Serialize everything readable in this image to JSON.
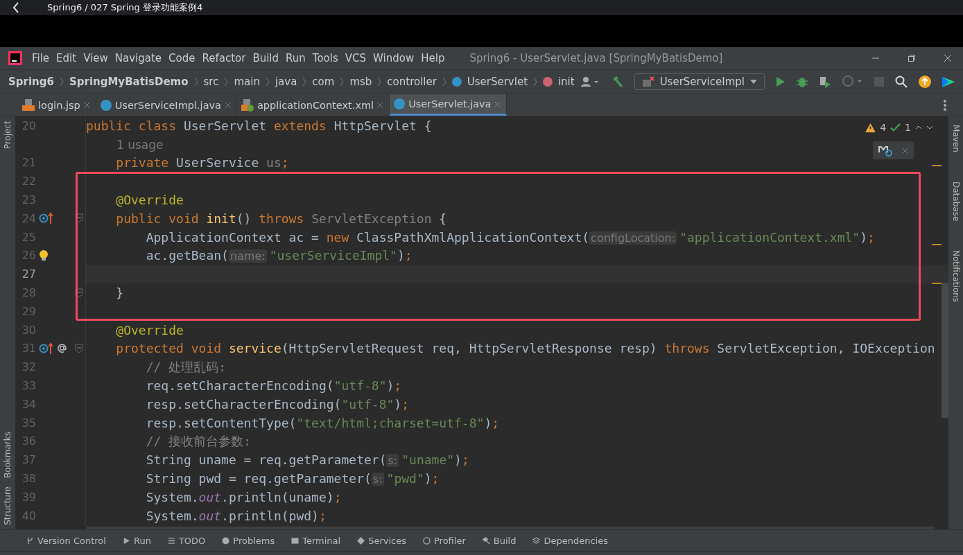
{
  "video_bar": {
    "title": "Spring6 / 027 Spring 登录功能案例4"
  },
  "window": {
    "title": "Spring6 - UserServlet.java [SpringMyBatisDemo]"
  },
  "menu": [
    "File",
    "Edit",
    "View",
    "Navigate",
    "Code",
    "Refactor",
    "Build",
    "Run",
    "Tools",
    "VCS",
    "Window",
    "Help"
  ],
  "breadcrumbs": [
    {
      "label": "Spring6",
      "kind": "bold"
    },
    {
      "label": "SpringMyBatisDemo",
      "kind": "bold"
    },
    {
      "label": "src",
      "kind": "plain"
    },
    {
      "label": "main",
      "kind": "plain"
    },
    {
      "label": "java",
      "kind": "plain"
    },
    {
      "label": "com",
      "kind": "plain"
    },
    {
      "label": "msb",
      "kind": "plain"
    },
    {
      "label": "controller",
      "kind": "plain"
    },
    {
      "label": "UserServlet",
      "kind": "class"
    },
    {
      "label": "init",
      "kind": "method"
    }
  ],
  "run_config": {
    "label": "UserServiceImpl"
  },
  "tabs": [
    {
      "label": "login.jsp",
      "kind": "jsp",
      "selected": false
    },
    {
      "label": "UserServiceImpl.java",
      "kind": "class",
      "selected": false
    },
    {
      "label": "applicationContext.xml",
      "kind": "xml",
      "selected": false
    },
    {
      "label": "UserServlet.java",
      "kind": "class",
      "selected": true
    }
  ],
  "inspections": {
    "warnings": "4",
    "weak_warnings": "1"
  },
  "left_tools": [
    {
      "label": "Project",
      "kind": "top"
    },
    {
      "label": "Bookmarks",
      "kind": "bottom"
    },
    {
      "label": "Structure",
      "kind": "bottom"
    }
  ],
  "right_tools": [
    "Maven",
    "Database",
    "Notifications"
  ],
  "lines": [
    {
      "number": "20",
      "tokens": [
        {
          "kind": "kw",
          "s": "public class "
        },
        {
          "kind": "plain",
          "s": "UserServlet "
        },
        {
          "kind": "kw",
          "s": "extends "
        },
        {
          "kind": "plain",
          "s": "HttpServlet {"
        }
      ]
    },
    {
      "kind": "usage",
      "text": "1 usage"
    },
    {
      "number": "21",
      "tokens": [
        {
          "kind": "kw",
          "s": "    private "
        },
        {
          "kind": "plain",
          "s": "UserService "
        },
        {
          "kind": "gray",
          "s": "us"
        },
        {
          "kind": "kw",
          "s": ";"
        }
      ]
    },
    {
      "number": "22",
      "boxed": true
    },
    {
      "number": "23",
      "boxed": true,
      "tokens": [
        {
          "kind": "ann",
          "s": "    @Override"
        }
      ]
    },
    {
      "number": "24",
      "boxed": true,
      "fold": true,
      "gutter": [
        {
          "kind": "override"
        }
      ],
      "tokens": [
        {
          "kind": "kw",
          "s": "    public void "
        },
        {
          "kind": "fn",
          "s": "init"
        },
        {
          "kind": "plain",
          "s": "() "
        },
        {
          "kind": "kw",
          "s": "throws "
        },
        {
          "kind": "gray",
          "s": "ServletException"
        },
        {
          "kind": "plain",
          "s": " {"
        }
      ]
    },
    {
      "number": "25",
      "boxed": true,
      "tokens": [
        {
          "kind": "plain",
          "s": "        ApplicationContext ac = "
        },
        {
          "kind": "kw",
          "s": "new "
        },
        {
          "kind": "plain",
          "s": "ClassPathXmlApplicationContext("
        },
        {
          "kind": "hint",
          "s": "configLocation:"
        },
        {
          "kind": "str",
          "s": "\"applicationContext.xml\""
        },
        {
          "kind": "plain",
          "s": ")"
        },
        {
          "kind": "kw",
          "s": ";"
        }
      ]
    },
    {
      "number": "26",
      "boxed": true,
      "gutter": [
        {
          "kind": "bulb"
        }
      ],
      "tokens": [
        {
          "kind": "plain",
          "s": "        ac.getBean("
        },
        {
          "kind": "hint",
          "s": "name:"
        },
        {
          "kind": "str",
          "s": "\"userServiceImpl\""
        },
        {
          "kind": "plain",
          "s": ")"
        },
        {
          "kind": "kw",
          "s": ";"
        }
      ]
    },
    {
      "number": "27",
      "boxed": true,
      "current": true
    },
    {
      "number": "28",
      "boxed": true,
      "fold": true,
      "tokens": [
        {
          "kind": "plain",
          "s": "    }"
        }
      ]
    },
    {
      "number": "29",
      "boxed": true
    },
    {
      "number": "30",
      "tokens": [
        {
          "kind": "ann",
          "s": "    @Override"
        }
      ]
    },
    {
      "number": "31",
      "fold": true,
      "gutter": [
        {
          "kind": "override"
        },
        {
          "kind": "at"
        }
      ],
      "tokens": [
        {
          "kind": "kw",
          "s": "    protected void "
        },
        {
          "kind": "fn",
          "s": "service"
        },
        {
          "kind": "plain",
          "s": "(HttpServletRequest req, HttpServletResponse resp) "
        },
        {
          "kind": "kw",
          "s": "throws "
        },
        {
          "kind": "plain",
          "s": "ServletException, IOException"
        }
      ]
    },
    {
      "number": "32",
      "tokens": [
        {
          "kind": "comment",
          "s": "        // 处理乱码:"
        }
      ]
    },
    {
      "number": "33",
      "tokens": [
        {
          "kind": "plain",
          "s": "        req.setCharacterEncoding("
        },
        {
          "kind": "str",
          "s": "\"utf-8\""
        },
        {
          "kind": "plain",
          "s": ")"
        },
        {
          "kind": "kw",
          "s": ";"
        }
      ]
    },
    {
      "number": "34",
      "tokens": [
        {
          "kind": "plain",
          "s": "        resp.setCharacterEncoding("
        },
        {
          "kind": "str",
          "s": "\"utf-8\""
        },
        {
          "kind": "plain",
          "s": ")"
        },
        {
          "kind": "kw",
          "s": ";"
        }
      ]
    },
    {
      "number": "35",
      "tokens": [
        {
          "kind": "plain",
          "s": "        resp.setContentType("
        },
        {
          "kind": "str",
          "s": "\"text/html;charset=utf-8\""
        },
        {
          "kind": "plain",
          "s": ")"
        },
        {
          "kind": "kw",
          "s": ";"
        }
      ]
    },
    {
      "number": "36",
      "tokens": [
        {
          "kind": "comment",
          "s": "        // 接收前台参数:"
        }
      ]
    },
    {
      "number": "37",
      "tokens": [
        {
          "kind": "plain",
          "s": "        String uname = req.getParameter("
        },
        {
          "kind": "hint",
          "s": "s:"
        },
        {
          "kind": "str",
          "s": "\"uname\""
        },
        {
          "kind": "plain",
          "s": ")"
        },
        {
          "kind": "kw",
          "s": ";"
        }
      ]
    },
    {
      "number": "38",
      "tokens": [
        {
          "kind": "plain",
          "s": "        String pwd = req.getParameter("
        },
        {
          "kind": "hint",
          "s": "s:"
        },
        {
          "kind": "str",
          "s": "\"pwd\""
        },
        {
          "kind": "plain",
          "s": ")"
        },
        {
          "kind": "kw",
          "s": ";"
        }
      ]
    },
    {
      "number": "39",
      "tokens": [
        {
          "kind": "plain",
          "s": "        System."
        },
        {
          "kind": "static",
          "s": "out"
        },
        {
          "kind": "plain",
          "s": ".println(uname)"
        },
        {
          "kind": "kw",
          "s": ";"
        }
      ]
    },
    {
      "number": "40",
      "tokens": [
        {
          "kind": "plain",
          "s": "        System."
        },
        {
          "kind": "static",
          "s": "out"
        },
        {
          "kind": "plain",
          "s": ".println(pwd)"
        },
        {
          "kind": "kw",
          "s": ";"
        }
      ]
    }
  ],
  "bottom_tools": [
    {
      "label": "Version Control",
      "kind": "vcs"
    },
    {
      "label": "Run",
      "kind": "run"
    },
    {
      "label": "TODO",
      "kind": "todo"
    },
    {
      "label": "Problems",
      "kind": "problems"
    },
    {
      "label": "Terminal",
      "kind": "terminal"
    },
    {
      "label": "Services",
      "kind": "services"
    },
    {
      "label": "Profiler",
      "kind": "profiler"
    },
    {
      "label": "Build",
      "kind": "build"
    },
    {
      "label": "Dependencies",
      "kind": "deps"
    }
  ]
}
